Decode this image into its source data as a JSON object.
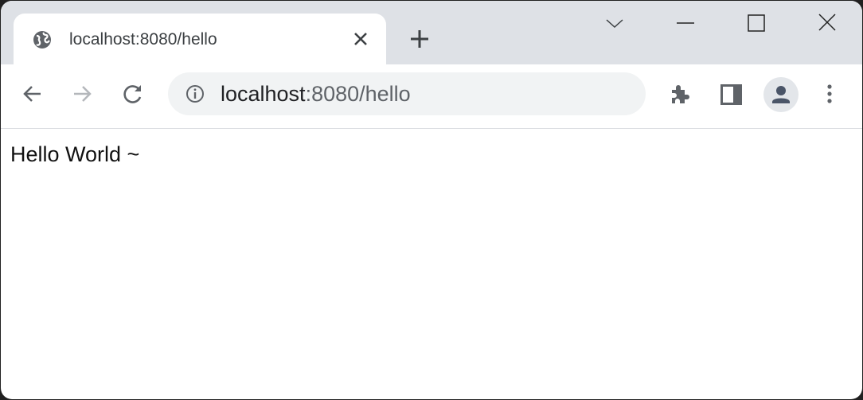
{
  "tab": {
    "title": "localhost:8080/hello",
    "favicon": "globe-icon"
  },
  "omnibox": {
    "host": "localhost",
    "rest": ":8080/hello"
  },
  "page": {
    "text": "Hello World ~"
  },
  "colors": {
    "tabstrip": "#dee1e6",
    "omnibox": "#f1f3f4",
    "icon": "#5f6368"
  }
}
